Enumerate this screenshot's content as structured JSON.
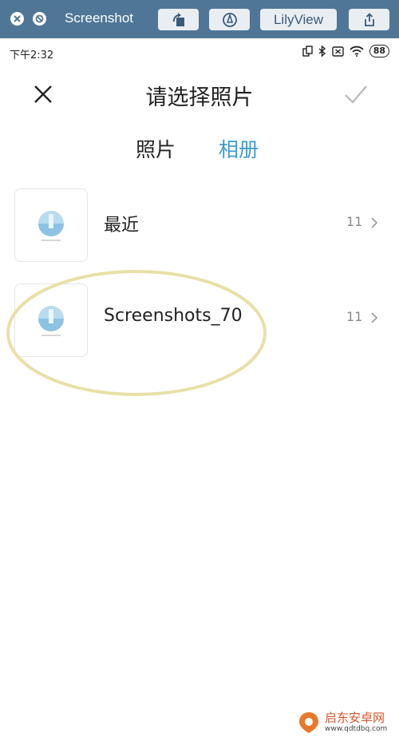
{
  "window": {
    "title": "Screenshot",
    "lilyview_label": "LilyView"
  },
  "statusbar": {
    "time": "下午2:32",
    "battery": "88"
  },
  "header": {
    "title": "请选择照片"
  },
  "tabs": [
    {
      "label": "照片",
      "active": false
    },
    {
      "label": "相册",
      "active": true
    }
  ],
  "albums": [
    {
      "name": "最近",
      "count": "11",
      "thumb": "lighthouse-thumbnail"
    },
    {
      "name": "Screenshots_70",
      "count": "11",
      "thumb": "lighthouse-thumbnail"
    }
  ],
  "watermark": {
    "line1": "启东安卓网",
    "line2": "www.qdtdbq.com"
  },
  "colors": {
    "toolbar_bg": "#4f7696",
    "accent": "#3b9ccf",
    "highlight": "#e8e0a8"
  },
  "icons": [
    "close-window-icon",
    "block-icon",
    "rotate-icon",
    "annotate-icon",
    "share-icon",
    "close-icon",
    "checkmark-icon",
    "chevron-right-icon",
    "wifi-icon",
    "bluetooth-icon"
  ]
}
